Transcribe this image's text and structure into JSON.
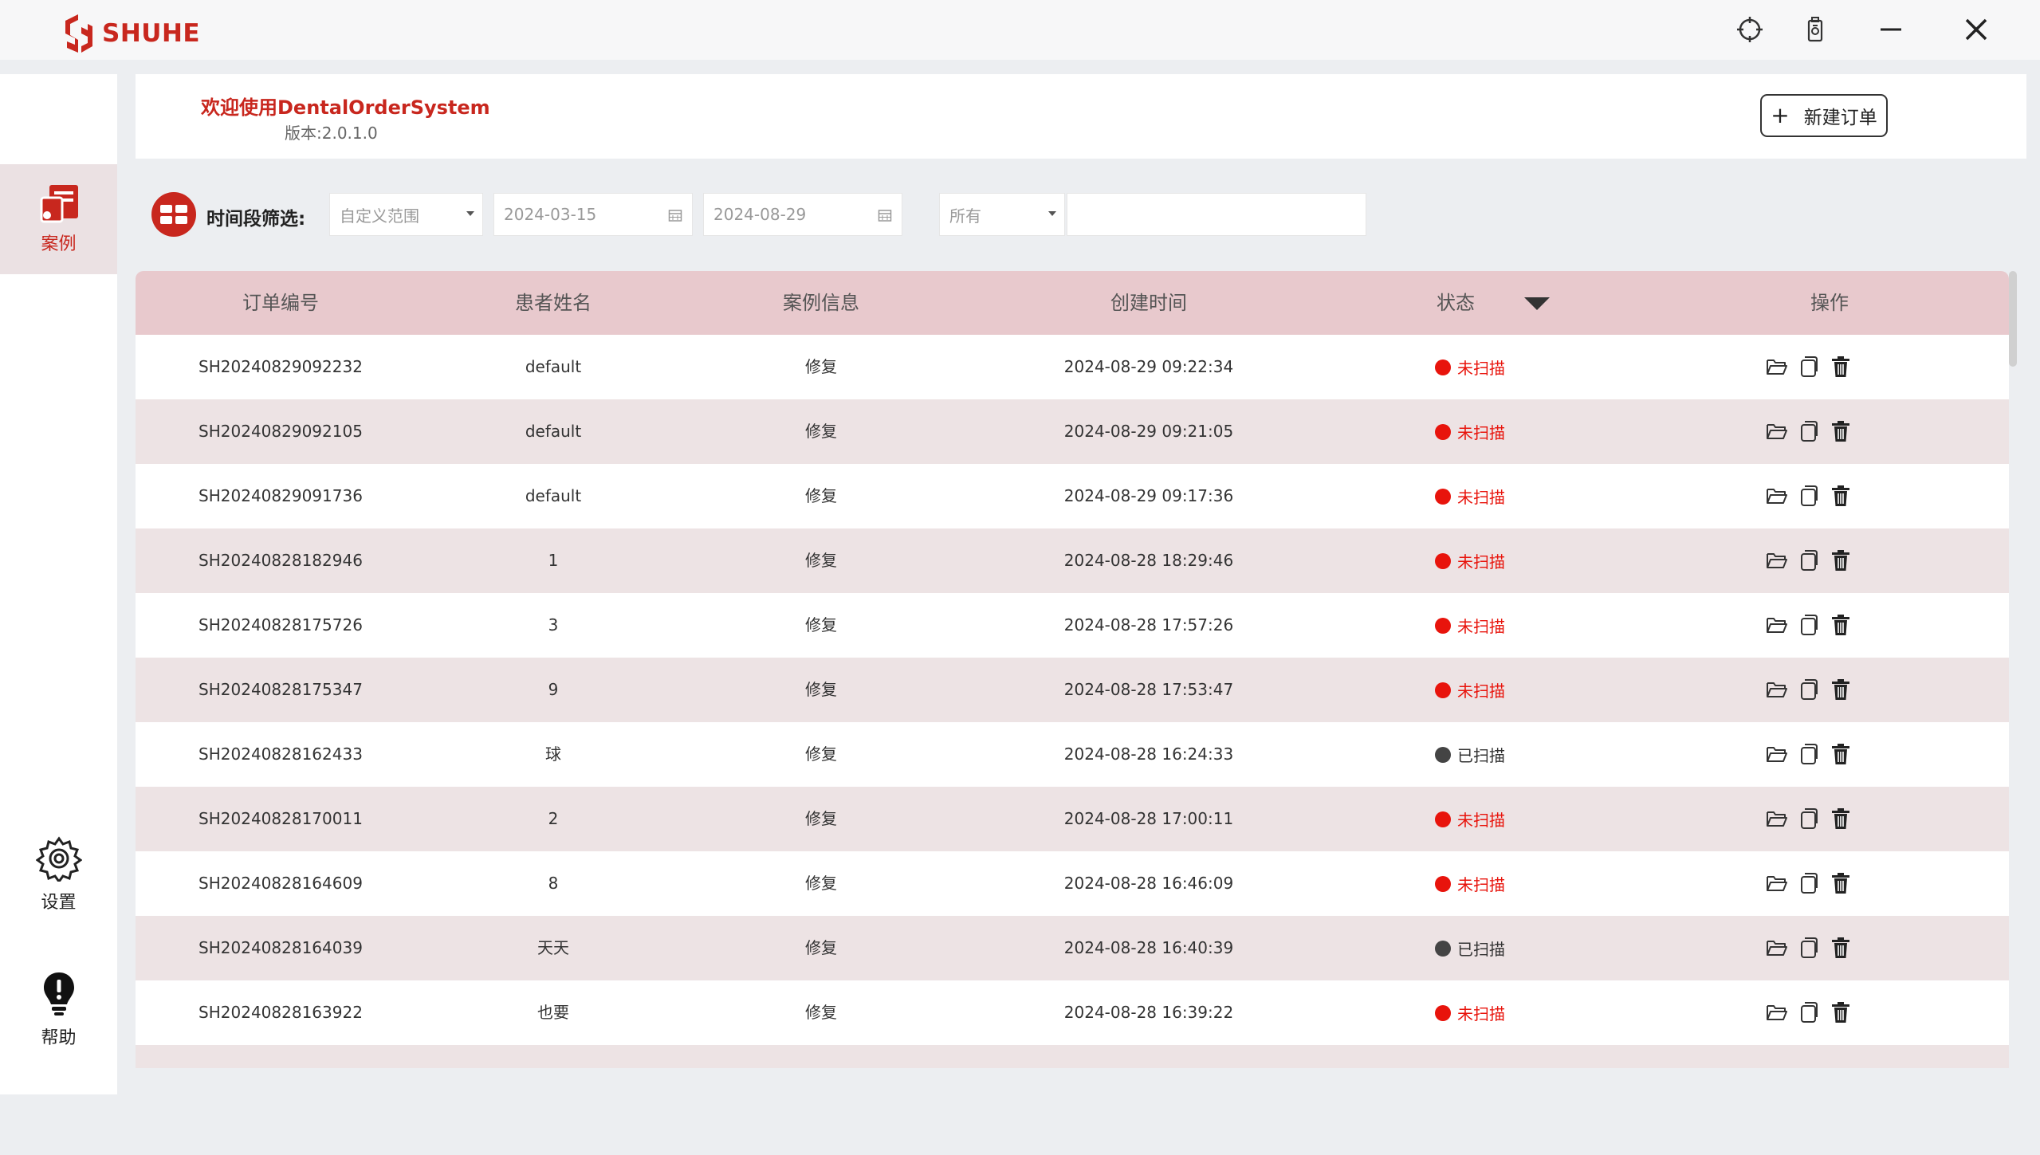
{
  "app": {
    "brand": "SHUHE"
  },
  "sidebar": {
    "items": [
      {
        "label": "案例"
      },
      {
        "label": "设置"
      },
      {
        "label": "帮助"
      }
    ]
  },
  "header": {
    "welcome": "欢迎使用DentalOrderSystem",
    "version": "版本:2.0.1.0",
    "new_order_label": "新建订单"
  },
  "filter": {
    "label": "时间段筛选:",
    "range_value": "自定义范围",
    "date_start": "2024-03-15",
    "date_end": "2024-08-29",
    "status_value": "所有",
    "search_value": ""
  },
  "table": {
    "columns": [
      "订单编号",
      "患者姓名",
      "案例信息",
      "创建时间",
      "状态",
      "操作"
    ],
    "rows": [
      {
        "order_no": "SH20240829092232",
        "patient": "default",
        "case_info": "修复",
        "created": "2024-08-29 09:22:34",
        "status": "未扫描",
        "scanned": false
      },
      {
        "order_no": "SH20240829092105",
        "patient": "default",
        "case_info": "修复",
        "created": "2024-08-29 09:21:05",
        "status": "未扫描",
        "scanned": false
      },
      {
        "order_no": "SH20240829091736",
        "patient": "default",
        "case_info": "修复",
        "created": "2024-08-29 09:17:36",
        "status": "未扫描",
        "scanned": false
      },
      {
        "order_no": "SH20240828182946",
        "patient": "1",
        "case_info": "修复",
        "created": "2024-08-28 18:29:46",
        "status": "未扫描",
        "scanned": false
      },
      {
        "order_no": "SH20240828175726",
        "patient": "3",
        "case_info": "修复",
        "created": "2024-08-28 17:57:26",
        "status": "未扫描",
        "scanned": false
      },
      {
        "order_no": "SH20240828175347",
        "patient": "9",
        "case_info": "修复",
        "created": "2024-08-28 17:53:47",
        "status": "未扫描",
        "scanned": false
      },
      {
        "order_no": "SH20240828162433",
        "patient": "球",
        "case_info": "修复",
        "created": "2024-08-28 16:24:33",
        "status": "已扫描",
        "scanned": true
      },
      {
        "order_no": "SH20240828170011",
        "patient": "2",
        "case_info": "修复",
        "created": "2024-08-28 17:00:11",
        "status": "未扫描",
        "scanned": false
      },
      {
        "order_no": "SH20240828164609",
        "patient": "8",
        "case_info": "修复",
        "created": "2024-08-28 16:46:09",
        "status": "未扫描",
        "scanned": false
      },
      {
        "order_no": "SH20240828164039",
        "patient": "天天",
        "case_info": "修复",
        "created": "2024-08-28 16:40:39",
        "status": "已扫描",
        "scanned": true
      },
      {
        "order_no": "SH20240828163922",
        "patient": "也要",
        "case_info": "修复",
        "created": "2024-08-28 16:39:22",
        "status": "未扫描",
        "scanned": false
      }
    ]
  },
  "colors": {
    "brand_red": "#c8271e",
    "status_unscanned": "#e8140c",
    "status_scanned": "#444444",
    "header_row_bg": "#e8c9cd",
    "even_row_bg": "#ede3e4"
  },
  "icons": {
    "row_actions": [
      "folder-icon",
      "copy-icon",
      "trash-icon"
    ],
    "window": [
      "crosshair-icon",
      "device-icon",
      "minimize-icon",
      "close-icon"
    ]
  }
}
